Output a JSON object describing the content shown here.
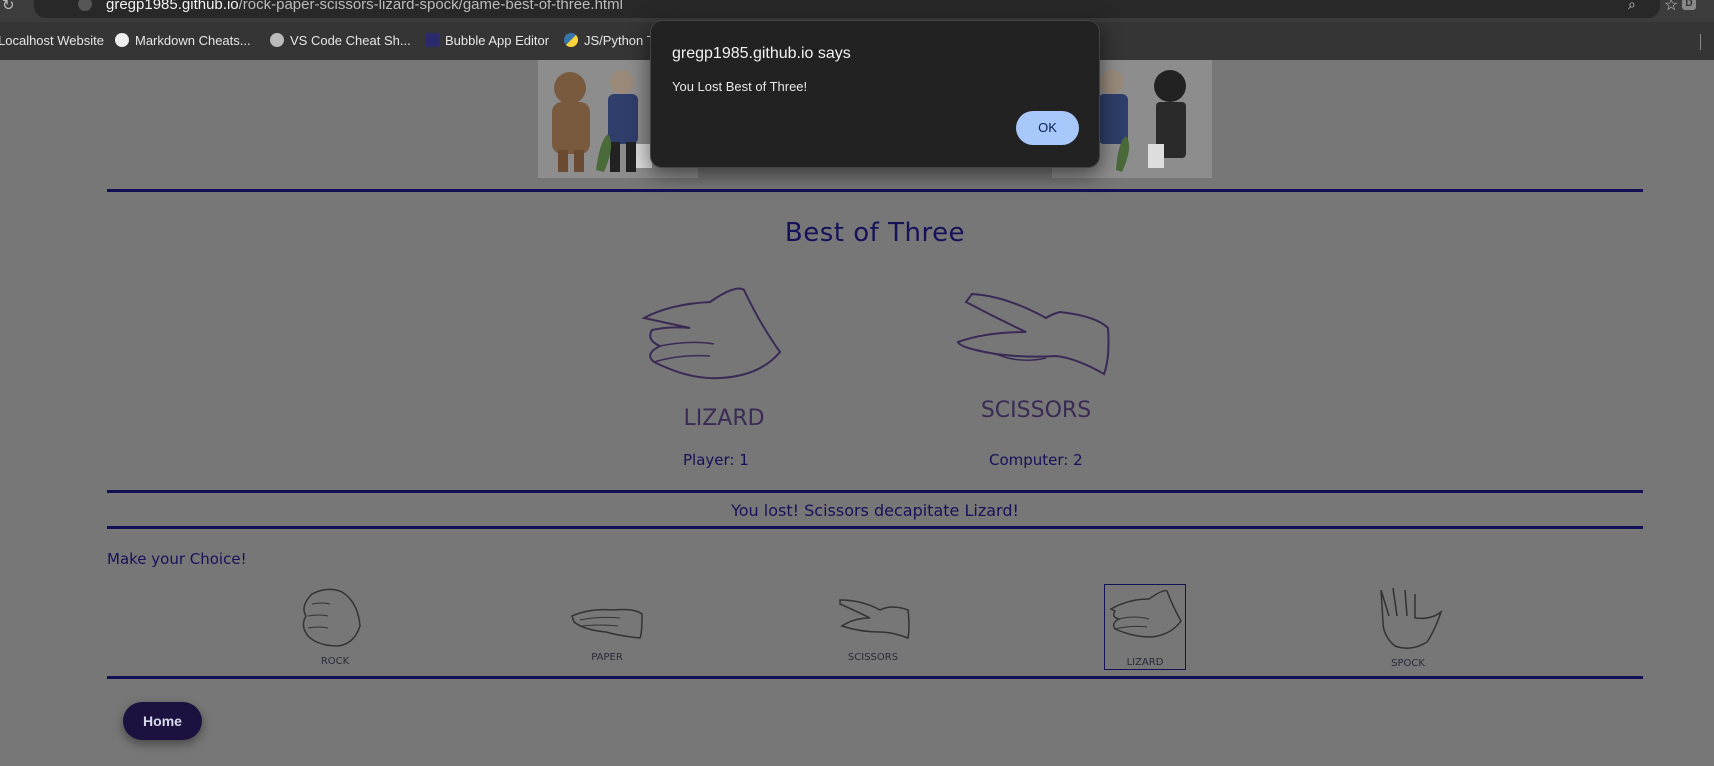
{
  "browser": {
    "url_host": "gregp1985.github.io",
    "url_path": "/rock-paper-scissors-lizard-spock/game-best-of-three.html",
    "bookmarks": [
      {
        "label": "Localhost Website",
        "icon": "globe-icon"
      },
      {
        "label": "Markdown Cheats...",
        "icon": "github-icon"
      },
      {
        "label": "VS Code Cheat Sh...",
        "icon": "globe-icon"
      },
      {
        "label": "Bubble App Editor",
        "icon": "bubble-icon"
      },
      {
        "label": "JS/Python T",
        "icon": "python-icon"
      }
    ],
    "profile_initial": "D"
  },
  "game": {
    "title": "Best of Three",
    "player_choice": "LIZARD",
    "computer_choice": "SCISSORS",
    "player_score_text": "Player: 1",
    "computer_score_text": "Computer: 2",
    "result": "You lost! Scissors decapitate Lizard!",
    "choice_heading": "Make your Choice!",
    "choices": [
      {
        "label": "ROCK",
        "icon": "rock-hand-icon"
      },
      {
        "label": "PAPER",
        "icon": "paper-hand-icon"
      },
      {
        "label": "SCISSORS",
        "icon": "scissors-hand-icon"
      },
      {
        "label": "LIZARD",
        "icon": "lizard-hand-icon",
        "selected": true
      },
      {
        "label": "SPOCK",
        "icon": "spock-hand-icon"
      }
    ],
    "home_label": "Home"
  },
  "dialog": {
    "title": "gregp1985.github.io says",
    "message": "You Lost Best of Three!",
    "ok_label": "OK"
  },
  "colors": {
    "accent": "#15125a",
    "ok_button": "#a8c7fa",
    "dialog_bg": "#222222"
  }
}
